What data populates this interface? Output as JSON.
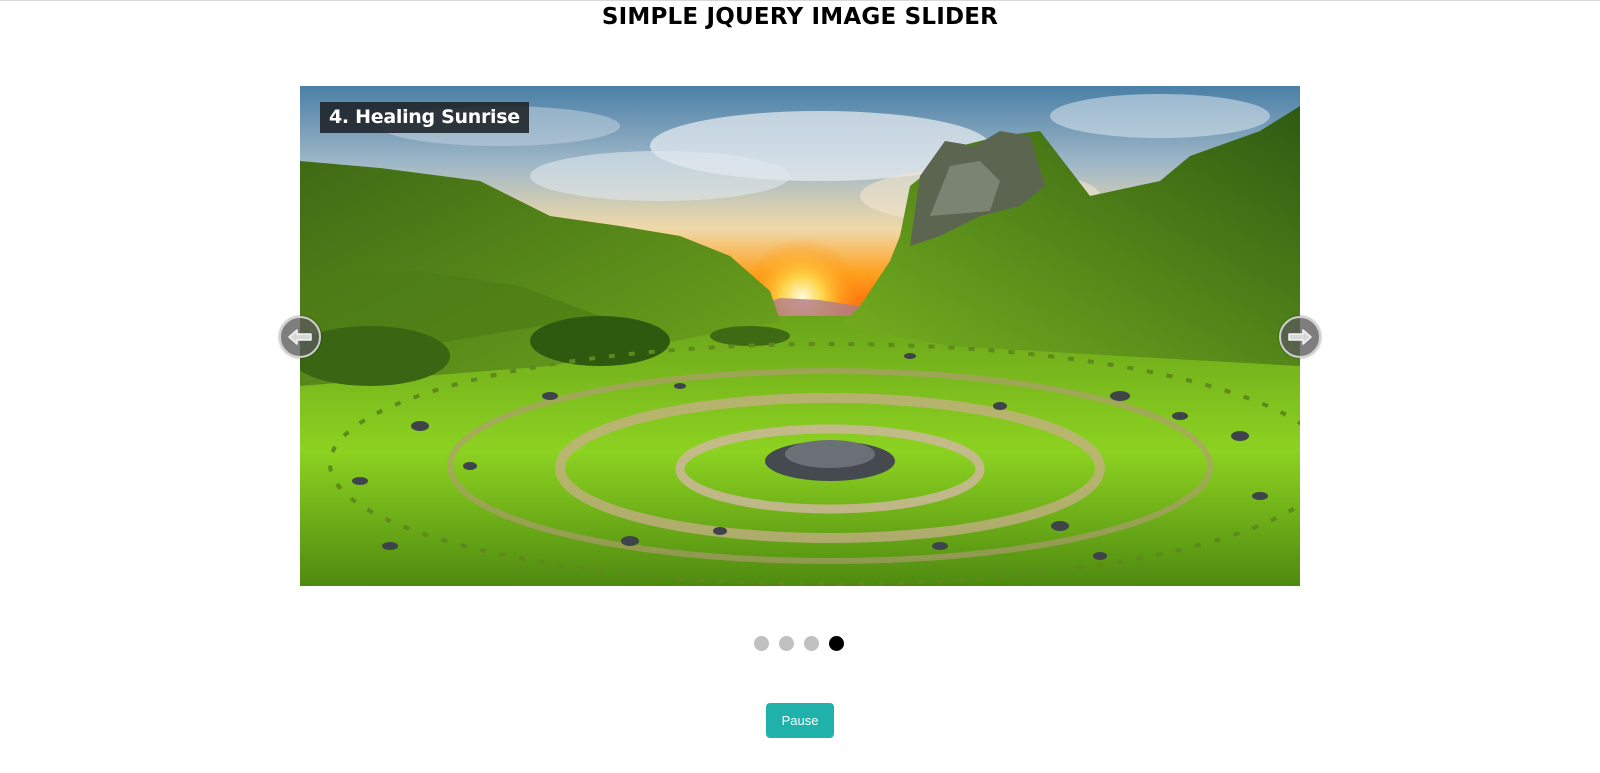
{
  "page": {
    "title": "SIMPLE JQUERY IMAGE SLIDER"
  },
  "slider": {
    "caption": "4. Healing Sunrise",
    "prev_icon": "arrow-left-icon",
    "next_icon": "arrow-right-icon",
    "slide_count": 4,
    "active_slide": 4
  },
  "controls": {
    "pause_label": "Pause"
  },
  "colors": {
    "accent": "#20b2aa",
    "dot_inactive": "#c0c0c0",
    "dot_active": "#000000",
    "caption_bg": "#1e2228"
  }
}
